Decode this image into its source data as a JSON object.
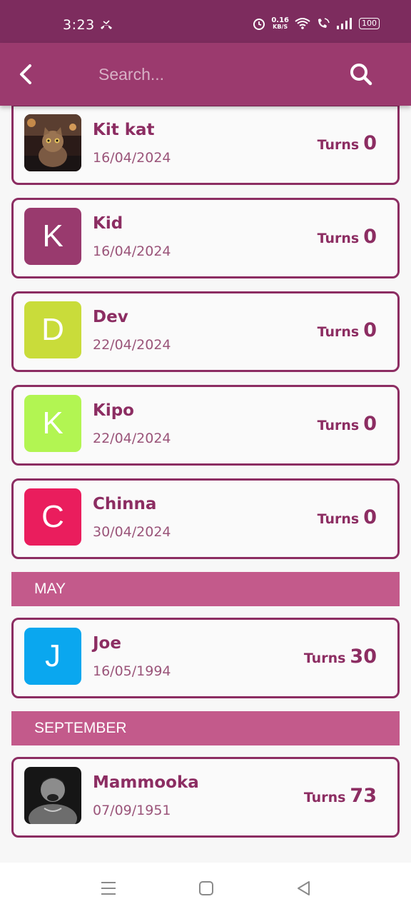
{
  "status": {
    "time": "3:23",
    "net_speed_value": "0.16",
    "net_speed_unit": "KB/S",
    "battery": "100"
  },
  "appbar": {
    "search_placeholder": "Search..."
  },
  "accent": "#9b3a6e",
  "entries": [
    {
      "name": "Kit kat",
      "date": "16/04/2024",
      "turns_label": "Turns",
      "turns": "0",
      "initial": "",
      "avatar": "cat-photo"
    },
    {
      "name": "Kid",
      "date": "16/04/2024",
      "turns_label": "Turns",
      "turns": "0",
      "initial": "K",
      "color": "#993a6e"
    },
    {
      "name": "Dev",
      "date": "22/04/2024",
      "turns_label": "Turns",
      "turns": "0",
      "initial": "D",
      "color": "#c9dc3a"
    },
    {
      "name": "Kipo",
      "date": "22/04/2024",
      "turns_label": "Turns",
      "turns": "0",
      "initial": "K",
      "color": "#b2f552"
    },
    {
      "name": "Chinna",
      "date": "30/04/2024",
      "turns_label": "Turns",
      "turns": "0",
      "initial": "C",
      "color": "#ea1d5d"
    }
  ],
  "sections": [
    {
      "month": "MAY",
      "entries": [
        {
          "name": "Joe",
          "date": "16/05/1994",
          "turns_label": "Turns",
          "turns": "30",
          "initial": "J",
          "color": "#0aa7ef"
        }
      ]
    },
    {
      "month": "SEPTEMBER",
      "entries": [
        {
          "name": "Mammooka",
          "date": "07/09/1951",
          "turns_label": "Turns",
          "turns": "73",
          "initial": "",
          "avatar": "person-photo"
        }
      ]
    }
  ]
}
